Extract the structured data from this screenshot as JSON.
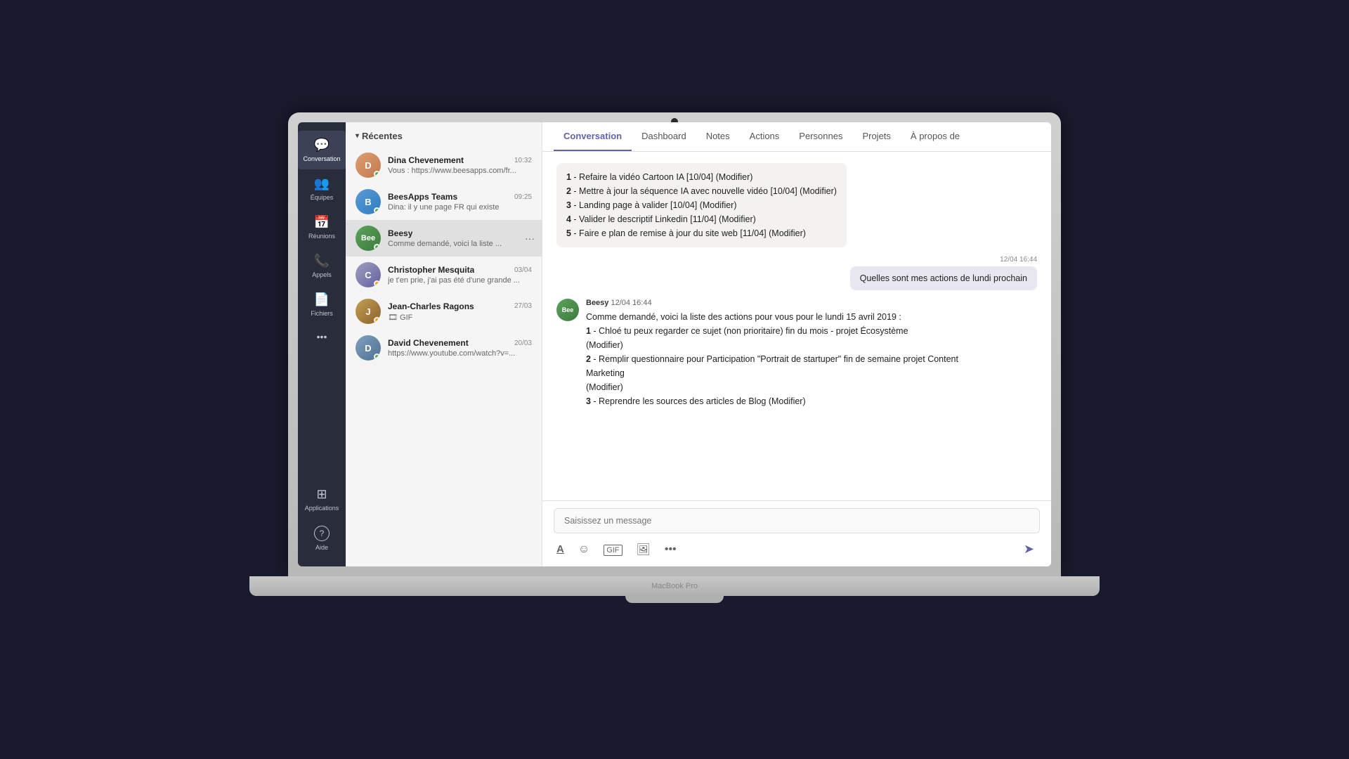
{
  "macbook": {
    "label": "MacBook Pro"
  },
  "rail": {
    "items": [
      {
        "id": "conversation",
        "icon": "💬",
        "label": "Conversation",
        "active": true
      },
      {
        "id": "equipes",
        "icon": "👥",
        "label": "Équipes",
        "active": false
      },
      {
        "id": "reunions",
        "icon": "📅",
        "label": "Réunions",
        "active": false
      },
      {
        "id": "appels",
        "icon": "📞",
        "label": "Appels",
        "active": false
      },
      {
        "id": "fichiers",
        "icon": "📄",
        "label": "Fichiers",
        "active": false
      },
      {
        "id": "more",
        "icon": "•••",
        "label": "",
        "active": false
      }
    ],
    "bottom": [
      {
        "id": "applications",
        "icon": "⊞",
        "label": "Applications",
        "active": false
      },
      {
        "id": "aide",
        "icon": "?",
        "label": "Aide",
        "active": false
      }
    ]
  },
  "chat_list": {
    "header": "Récentes",
    "items": [
      {
        "id": "dina",
        "name": "Dina Chevenement",
        "time": "10:32",
        "preview": "Vous : https://www.beesapps.com/fr...",
        "avatar_class": "dina",
        "avatar_letter": "D",
        "status": "online",
        "active": false
      },
      {
        "id": "beesapps-teams",
        "name": "BeesApps Teams",
        "time": "09:25",
        "preview": "Dina: il y une page FR qui existe",
        "avatar_class": "beesapps-teams",
        "avatar_letter": "B",
        "status": "online",
        "active": false
      },
      {
        "id": "beesy",
        "name": "Beesy",
        "time": "",
        "preview": "Comme demandé, voici la liste ...",
        "avatar_class": "beesy",
        "avatar_letter": "B",
        "status": "online",
        "active": true,
        "more": "···"
      },
      {
        "id": "christopher",
        "name": "Christopher Mesquita",
        "time": "03/04",
        "preview": "je t'en prie, j'ai pas été d'une grande ...",
        "avatar_class": "christopher",
        "avatar_letter": "C",
        "status": "away",
        "active": false
      },
      {
        "id": "jean-charles",
        "name": "Jean-Charles Ragons",
        "time": "27/03",
        "preview": "🎞 GIF",
        "avatar_class": "jean-charles",
        "avatar_letter": "J",
        "status": "away",
        "active": false
      },
      {
        "id": "david",
        "name": "David Chevenement",
        "time": "20/03",
        "preview": "https://www.youtube.com/watch?v=...",
        "avatar_class": "david",
        "avatar_letter": "D",
        "status": "online",
        "active": false
      }
    ]
  },
  "tabs": {
    "items": [
      {
        "id": "conversation",
        "label": "Conversation",
        "active": true
      },
      {
        "id": "dashboard",
        "label": "Dashboard",
        "active": false
      },
      {
        "id": "notes",
        "label": "Notes",
        "active": false
      },
      {
        "id": "actions",
        "label": "Actions",
        "active": false
      },
      {
        "id": "personnes",
        "label": "Personnes",
        "active": false
      },
      {
        "id": "projets",
        "label": "Projets",
        "active": false
      },
      {
        "id": "apropos",
        "label": "À propos de",
        "active": false
      }
    ]
  },
  "messages": {
    "partial_msg": {
      "lines": [
        "1 - Refaire la vidéo Cartoon IA [10/04] (Modifier)",
        "2 - Mettre à jour la séquence IA avec nouvelle vidéo [10/04] (Modifier)",
        "3 - Landing page à valider [10/04] (Modifier)",
        "4 - Valider le descriptif Linkedin [11/04] (Modifier)",
        "5 - Faire e plan de remise à jour du site web [11/04] (Modifier)"
      ]
    },
    "outgoing": {
      "time": "12/04 16:44",
      "text": "Quelles sont mes actions de lundi prochain"
    },
    "incoming": {
      "sender": "Beesy",
      "time": "12/04 16:44",
      "intro": "Comme demandé, voici la liste des actions pour vous pour le lundi 15 avril 2019 :",
      "items": [
        "1 - Chloé tu peux regarder ce sujet (non prioritaire) fin du mois - projet Écosystème (Modifier)",
        "2 - Remplir questionnaire pour Participation \"Portrait de startuper\" fin de semaine projet Content Marketing (Modifier)",
        "3 - Reprendre les sources des articles de Blog (Modifier)"
      ]
    }
  },
  "input": {
    "placeholder": "Saisissez un message"
  },
  "toolbar": {
    "format_icon": "A",
    "emoji_icon": "☺",
    "gif_icon": "GIF",
    "sticker_icon": "🖼",
    "more_icon": "•••",
    "send_icon": "➤"
  }
}
